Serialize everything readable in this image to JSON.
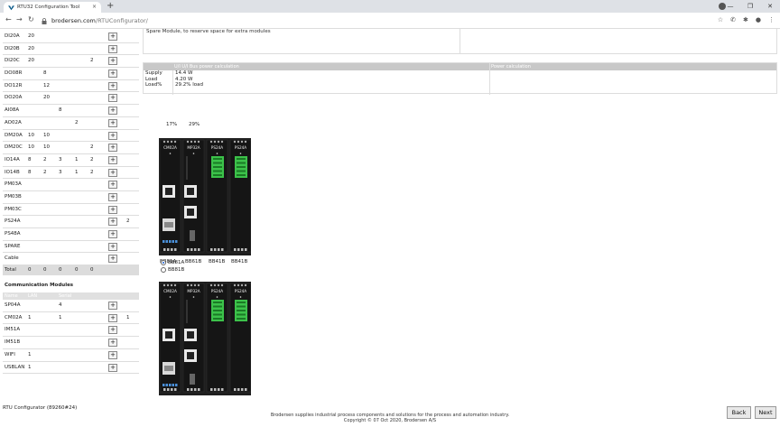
{
  "browser": {
    "tab_title": "RTU32 Configuration Tool",
    "tab_close": "×",
    "new_tab": "+",
    "url_host": "brodersen.com",
    "url_path": "/RTUConfigurator/",
    "window_min": "—",
    "window_max": "❐",
    "window_close": "✕"
  },
  "modules": [
    {
      "name": "DI20A",
      "v1": "20",
      "v2": "",
      "v3": "",
      "v4": "",
      "v5": "",
      "extra": ""
    },
    {
      "name": "DI20B",
      "v1": "20",
      "v2": "",
      "v3": "",
      "v4": "",
      "v5": "",
      "extra": ""
    },
    {
      "name": "DI20C",
      "v1": "20",
      "v2": "",
      "v3": "",
      "v4": "",
      "v5": "2",
      "extra": ""
    },
    {
      "name": "DO08R",
      "v1": "",
      "v2": "8",
      "v3": "",
      "v4": "",
      "v5": "",
      "extra": ""
    },
    {
      "name": "DO12R",
      "v1": "",
      "v2": "12",
      "v3": "",
      "v4": "",
      "v5": "",
      "extra": ""
    },
    {
      "name": "DO20A",
      "v1": "",
      "v2": "20",
      "v3": "",
      "v4": "",
      "v5": "",
      "extra": ""
    },
    {
      "name": "AI08A",
      "v1": "",
      "v2": "",
      "v3": "8",
      "v4": "",
      "v5": "",
      "extra": ""
    },
    {
      "name": "AO02A",
      "v1": "",
      "v2": "",
      "v3": "",
      "v4": "2",
      "v5": "",
      "extra": ""
    },
    {
      "name": "DM20A",
      "v1": "10",
      "v2": "10",
      "v3": "",
      "v4": "",
      "v5": "",
      "extra": ""
    },
    {
      "name": "DM20C",
      "v1": "10",
      "v2": "10",
      "v3": "",
      "v4": "",
      "v5": "2",
      "extra": ""
    },
    {
      "name": "IO14A",
      "v1": "8",
      "v2": "2",
      "v3": "3",
      "v4": "1",
      "v5": "2",
      "extra": ""
    },
    {
      "name": "IO14B",
      "v1": "8",
      "v2": "2",
      "v3": "3",
      "v4": "1",
      "v5": "2",
      "extra": ""
    },
    {
      "name": "PM03A",
      "v1": "",
      "v2": "",
      "v3": "",
      "v4": "",
      "v5": "",
      "extra": ""
    },
    {
      "name": "PM03B",
      "v1": "",
      "v2": "",
      "v3": "",
      "v4": "",
      "v5": "",
      "extra": ""
    },
    {
      "name": "PM03C",
      "v1": "",
      "v2": "",
      "v3": "",
      "v4": "",
      "v5": "",
      "extra": ""
    },
    {
      "name": "PS24A",
      "v1": "",
      "v2": "",
      "v3": "",
      "v4": "",
      "v5": "",
      "extra": "2"
    },
    {
      "name": "PS48A",
      "v1": "",
      "v2": "",
      "v3": "",
      "v4": "",
      "v5": "",
      "extra": ""
    },
    {
      "name": "SPARE",
      "v1": "",
      "v2": "",
      "v3": "",
      "v4": "",
      "v5": "",
      "extra": ""
    },
    {
      "name": "Cable",
      "v1": "",
      "v2": "",
      "v3": "",
      "v4": "",
      "v5": "",
      "extra": ""
    }
  ],
  "total": {
    "label": "Total",
    "v1": "0",
    "v2": "0",
    "v3": "0",
    "v4": "0",
    "v5": "0"
  },
  "plus_label": "+",
  "comm": {
    "title": "Communication Modules",
    "headers": {
      "name": "Name",
      "lan": "LAN",
      "serial": "Serial"
    },
    "rows": [
      {
        "name": "SP04A",
        "lan": "",
        "serial": "4",
        "extra": ""
      },
      {
        "name": "CM02A",
        "lan": "1",
        "serial": "1",
        "extra": "1"
      },
      {
        "name": "IM51A",
        "lan": "",
        "serial": "",
        "extra": ""
      },
      {
        "name": "IM51B",
        "lan": "",
        "serial": "",
        "extra": ""
      },
      {
        "name": "WIFI",
        "lan": "1",
        "serial": "",
        "extra": ""
      },
      {
        "name": "USBLAN",
        "lan": "1",
        "serial": "",
        "extra": ""
      }
    ]
  },
  "topbox_text": "Spare Module, to reserve space for extra modules",
  "power": {
    "header_left": "U/I U/I Bus power calculation",
    "header_right": "Power calculation",
    "rows": [
      {
        "label": "Supply",
        "value": "14.4 W"
      },
      {
        "label": "Load",
        "value": "4.20 W"
      },
      {
        "label": "Load%",
        "value": "29.2% load"
      }
    ]
  },
  "percent_1": "17%",
  "percent_2": "29%",
  "rack_module_labels": [
    "CM02A",
    "MP32A",
    "PS24A",
    "PS24A"
  ],
  "rack_bottom_labels": [
    "BB81A",
    "BB61B",
    "BB41B",
    "BB41B"
  ],
  "radio_options": [
    {
      "label": "BB81A",
      "selected": true
    },
    {
      "label": "BB81B",
      "selected": false
    }
  ],
  "status_text": "RTU Configurator (89260#24)",
  "footer_line1": "Brodersen supplies industrial process components and solutions for the process and automation industry.",
  "footer_line2": "Copyright © 07 Oct 2020, Brodersen A/S",
  "buttons": {
    "back": "Back",
    "next": "Next"
  },
  "colors": {
    "terminal_green": "#3cc24a",
    "rack_dark": "#1e1e1e",
    "tab_bar": "#dee1e6"
  }
}
